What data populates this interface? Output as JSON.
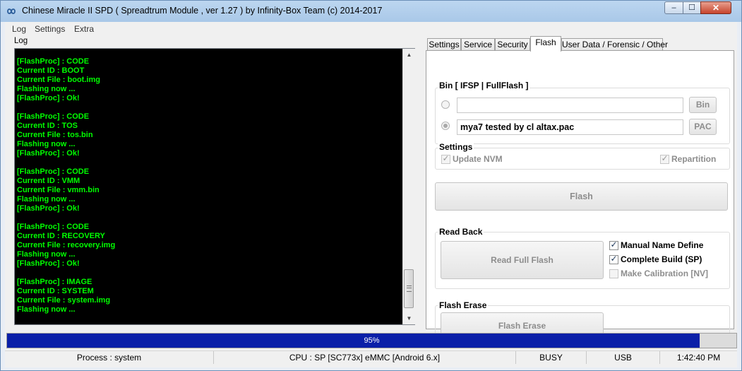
{
  "window": {
    "title": "Chinese Miracle II SPD ( Spreadtrum Module , ver 1.27 ) by Infinity-Box Team (c) 2014-2017",
    "min_glyph": "–",
    "max_glyph": "☐",
    "close_glyph": "✕"
  },
  "menu": [
    "Log",
    "Settings",
    "Extra"
  ],
  "log": {
    "label": "Log",
    "lines": [
      "[FlashProc] : CODE",
      "Current ID : BOOT",
      "Current File : boot.img",
      "Flashing now ...",
      "[FlashProc] : Ok!",
      "",
      "[FlashProc] : CODE",
      "Current ID : TOS",
      "Current File : tos.bin",
      "Flashing now ...",
      "[FlashProc] : Ok!",
      "",
      "[FlashProc] : CODE",
      "Current ID : VMM",
      "Current File : vmm.bin",
      "Flashing now ...",
      "[FlashProc] : Ok!",
      "",
      "[FlashProc] : CODE",
      "Current ID : RECOVERY",
      "Current File : recovery.img",
      "Flashing now ...",
      "[FlashProc] : Ok!",
      "",
      "[FlashProc] : IMAGE",
      "Current ID : SYSTEM",
      "Current File : system.img",
      "Flashing now ..."
    ]
  },
  "tabs": [
    "Settings",
    "Service",
    "Security",
    "Flash",
    "User Data / Forensic / Other"
  ],
  "active_tab": "Flash",
  "flash": {
    "bin_group_title": "Bin  [ IFSP | FullFlash ]",
    "bin_path": "",
    "bin_button": "Bin",
    "pac_path": "mya7 tested by cl altax.pac",
    "pac_button": "PAC",
    "settings_title": "Settings",
    "update_nvm": "Update NVM",
    "repartition": "Repartition",
    "flash_button": "Flash",
    "readback_title": "Read Back",
    "read_full_flash_button": "Read Full Flash",
    "manual_name_define": "Manual Name Define",
    "complete_build": "Complete Build (SP)",
    "make_calibration": "Make Calibration [NV]",
    "erase_title": "Flash Erase",
    "flash_erase_button": "Flash Erase"
  },
  "progress": {
    "value": 0.95,
    "label": "95%"
  },
  "status": {
    "process": "Process : system",
    "cpu": "CPU : SP [SC773x] eMMC [Android 6.x]",
    "state": "BUSY",
    "connection": "USB",
    "time": "1:42:40 PM"
  },
  "colors": {
    "log_text": "#00ff00",
    "progress_fill": "#0a1fa8"
  }
}
